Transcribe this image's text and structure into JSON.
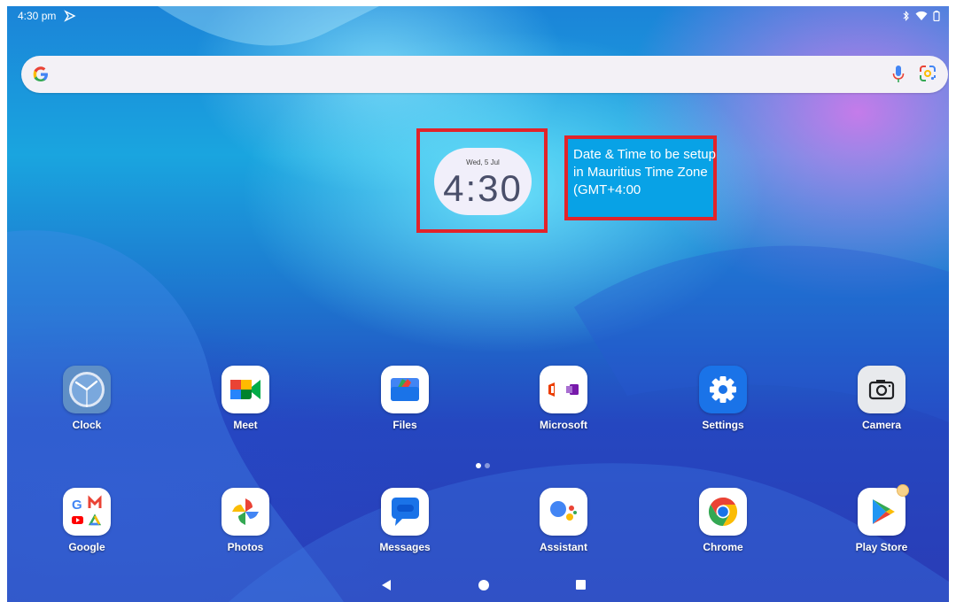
{
  "status_bar": {
    "time": "4:30 pm",
    "icons": [
      "cast-icon",
      "bluetooth-icon",
      "wifi-icon",
      "battery-icon"
    ]
  },
  "search_bar": {
    "logo": "google-g-icon",
    "mic": "mic-icon",
    "lens": "lens-icon"
  },
  "clock_widget": {
    "date": "Wed, 5 Jul",
    "time": "4:30"
  },
  "note": {
    "text": "Date & Time to be setup in Mauritius Time Zone (GMT+4:00"
  },
  "apps_row1": [
    {
      "label": "Clock",
      "icon": "clock-icon"
    },
    {
      "label": "Meet",
      "icon": "meet-icon"
    },
    {
      "label": "Files",
      "icon": "files-icon"
    },
    {
      "label": "Microsoft",
      "icon": "microsoft-icon"
    },
    {
      "label": "Settings",
      "icon": "settings-icon"
    },
    {
      "label": "Camera",
      "icon": "camera-icon"
    }
  ],
  "apps_row2": [
    {
      "label": "Google",
      "icon": "google-folder-icon"
    },
    {
      "label": "Photos",
      "icon": "photos-icon"
    },
    {
      "label": "Messages",
      "icon": "messages-icon"
    },
    {
      "label": "Assistant",
      "icon": "assistant-icon"
    },
    {
      "label": "Chrome",
      "icon": "chrome-icon"
    },
    {
      "label": "Play Store",
      "icon": "play-store-icon"
    }
  ],
  "page_indicator": {
    "current": 1,
    "total": 2
  },
  "nav_bar": {
    "buttons": [
      "back-icon",
      "home-icon",
      "recents-icon"
    ]
  },
  "colors": {
    "highlight_border": "#e2232a",
    "note_bg": "#08a2e6"
  }
}
